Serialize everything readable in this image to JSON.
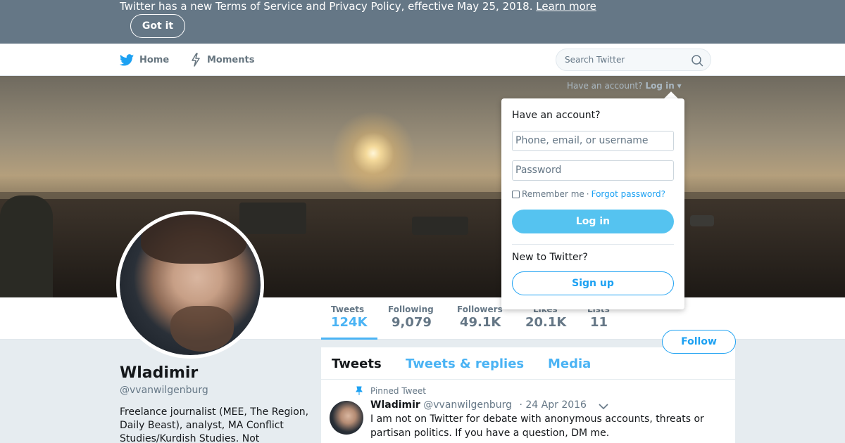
{
  "notice": {
    "text": "Twitter has a new Terms of Service and Privacy Policy, effective May 25, 2018.",
    "link": "Learn more",
    "button": "Got it"
  },
  "nav": {
    "home": "Home",
    "moments": "Moments",
    "search_placeholder": "Search Twitter",
    "login_prompt": "Have an account?",
    "login_label": "Log in"
  },
  "profile": {
    "name": "Wladimir",
    "handle": "@vvanwilgenburg",
    "bio": "Freelance journalist (MEE, The Region, Daily Beast), analyst, MA Conflict Studies/Kurdish Studies. Not"
  },
  "stats": [
    {
      "label": "Tweets",
      "value": "124K"
    },
    {
      "label": "Following",
      "value": "9,079"
    },
    {
      "label": "Followers",
      "value": "49.1K"
    },
    {
      "label": "Likes",
      "value": "20.1K"
    },
    {
      "label": "Lists",
      "value": "11"
    }
  ],
  "follow_button": "Follow",
  "timeline": {
    "tabs": [
      "Tweets",
      "Tweets & replies",
      "Media"
    ],
    "pinned_label": "Pinned Tweet",
    "tweet": {
      "name": "Wladimir",
      "handle": "@vvanwilgenburg",
      "date": "· 24 Apr 2016",
      "text": "I am not on Twitter for debate with anonymous accounts, threats or partisan politics. If you have a question, DM me."
    }
  },
  "login_dropdown": {
    "title": "Have an account?",
    "username_placeholder": "Phone, email, or username",
    "password_placeholder": "Password",
    "remember": "Remember me",
    "separator": "·",
    "forgot": "Forgot password?",
    "login_button": "Log in",
    "new_prompt": "New to Twitter?",
    "signup_button": "Sign up"
  },
  "colors": {
    "accent": "#1da1f2",
    "notice_bg": "#657786",
    "login_button_bg": "#55c3f0"
  }
}
